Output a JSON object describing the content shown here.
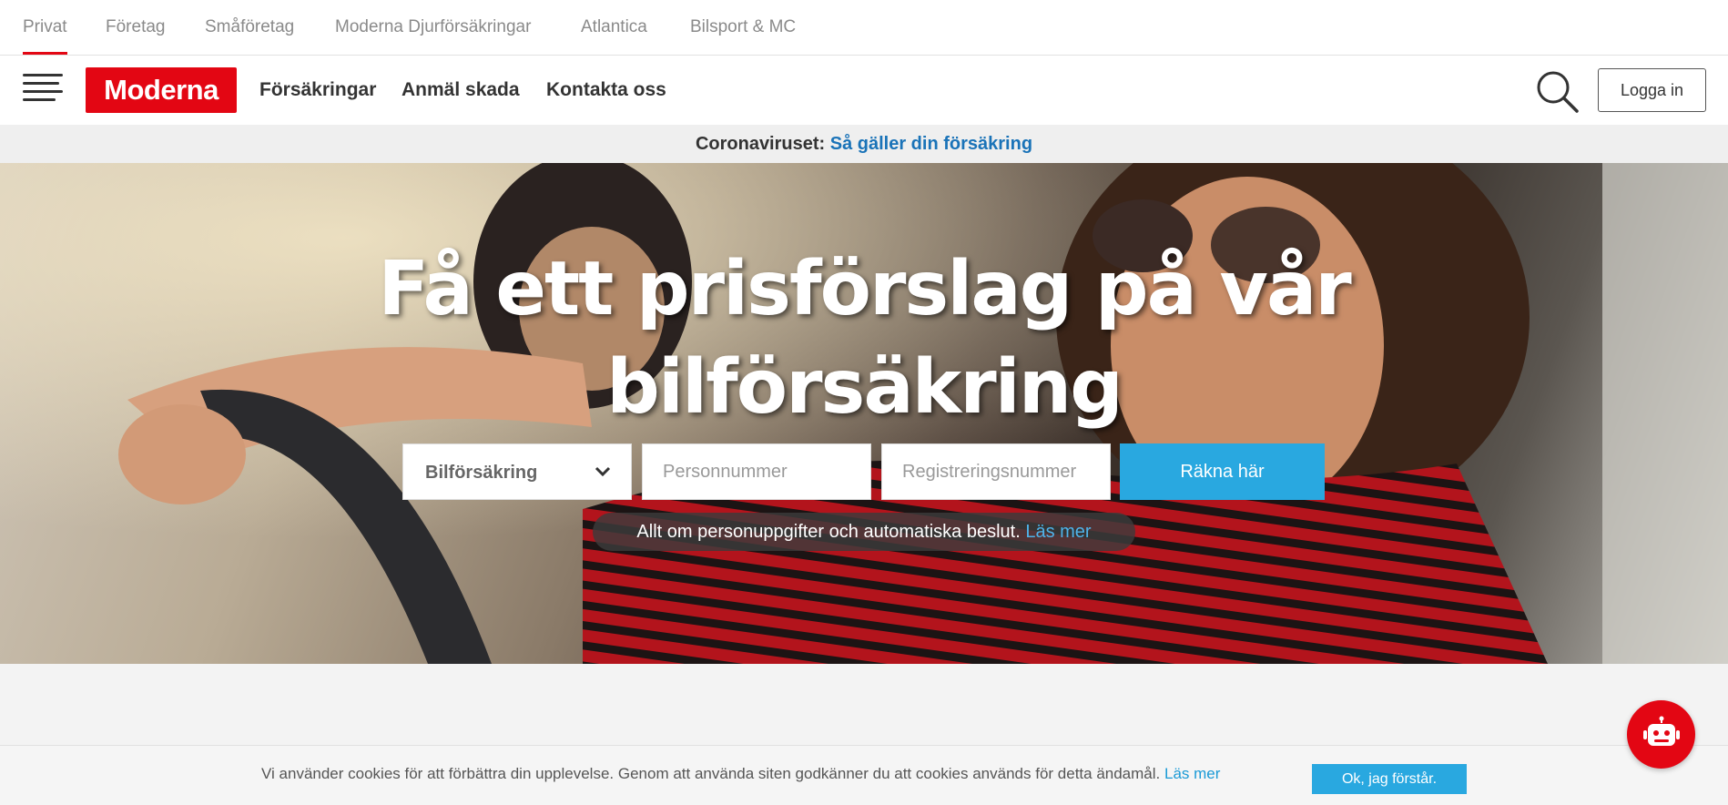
{
  "segments": [
    {
      "label": "Privat",
      "active": true
    },
    {
      "label": "Företag",
      "active": false
    },
    {
      "label": "Småföretag",
      "active": false
    },
    {
      "label": "Moderna Djurförsäkringar",
      "active": false
    },
    {
      "label": "Atlantica",
      "active": false
    },
    {
      "label": "Bilsport & MC",
      "active": false
    }
  ],
  "header": {
    "logo_text": "Moderna",
    "nav": [
      "Försäkringar",
      "Anmäl skada",
      "Kontakta oss"
    ],
    "login_label": "Logga in",
    "icons": {
      "menu": "hamburger-menu-icon",
      "search": "search-icon"
    }
  },
  "notice": {
    "label": "Coronaviruset:",
    "link": "Så gäller din försäkring"
  },
  "hero": {
    "title_line1": "Få ett prisförslag på vår",
    "title_line2": "bilförsäkring",
    "select_value": "Bilförsäkring",
    "personnummer_placeholder": "Personnummer",
    "registreringsnummer_placeholder": "Registreringsnummer",
    "submit_label": "Räkna här",
    "privacy_text": "Allt om personuppgifter och automatiska beslut.",
    "privacy_link": "Läs mer"
  },
  "cookie": {
    "text": "Vi använder cookies för att förbättra din upplevelse. Genom att använda siten godkänner du att cookies används för detta ändamål.",
    "link": "Läs mer",
    "accept_label": "Ok, jag förstår."
  },
  "colors": {
    "brand_red": "#e30613",
    "accent_blue": "#29a8e0",
    "link_blue": "#1a73b8"
  }
}
